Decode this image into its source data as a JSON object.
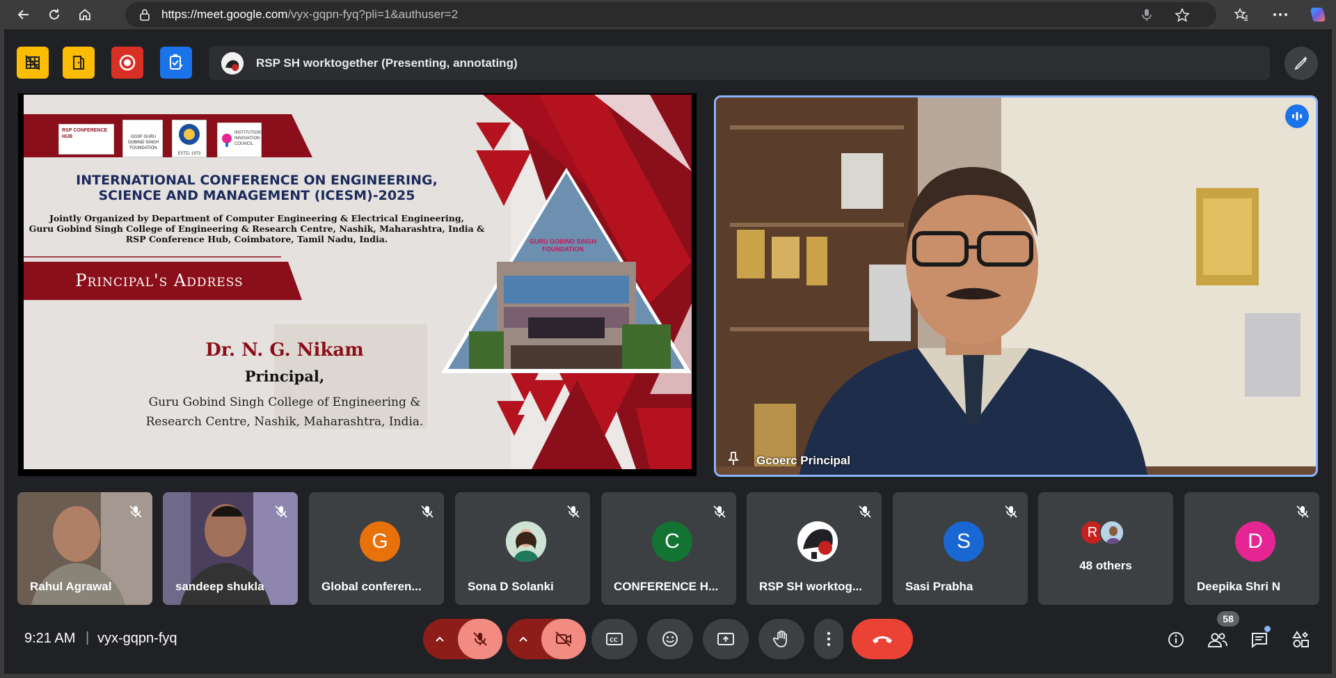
{
  "browser": {
    "url_host": "https://meet.google.com",
    "url_path": "/vyx-gqpn-fyq?pli=1&authuser=2"
  },
  "presentation": {
    "presenter_label": "RSP SH worktogether (Presenting, annotating)"
  },
  "slide": {
    "logos": [
      "RSP CONFERENCE HUB",
      "GGSF GURU GOBIND SINGH FOUNDATION",
      "ESTD. 1973",
      "INSTITUTION'S INNOVATION COUNCIL"
    ],
    "title_line1": "INTERNATIONAL CONFERENCE ON ENGINEERING,",
    "title_line2": "SCIENCE AND MANAGEMENT (ICESM)-2025",
    "org_line1": "Jointly Organized by Department of Computer Engineering & Electrical Engineering,",
    "org_line2": "Guru Gobind Singh College of Engineering & Research Centre, Nashik, Maharashtra, India &",
    "org_line3": "RSP Conference Hub, Coimbatore, Tamil Nadu, India.",
    "banner": "Principal's Address",
    "speaker_name": "Dr. N. G. Nikam",
    "speaker_role": "Principal,",
    "speaker_inst1": "Guru Gobind Singh College of Engineering &",
    "speaker_inst2": "Research Centre, Nashik, Maharashtra, India.",
    "building_sign": "GURU GOBIND SINGH FOUNDATION"
  },
  "main_video": {
    "name": "Gcoerc Principal"
  },
  "participants": [
    {
      "name": "Rahul Agrawal",
      "type": "video"
    },
    {
      "name": "sandeep shukla",
      "type": "video"
    },
    {
      "name": "Global conferen...",
      "initial": "G",
      "color": "#e8710a"
    },
    {
      "name": "Sona D Solanki",
      "type": "photo"
    },
    {
      "name": "CONFERENCE H...",
      "initial": "C",
      "color": "#137333"
    },
    {
      "name": "RSP SH worktog...",
      "type": "logo"
    },
    {
      "name": "Sasi Prabha",
      "initial": "S",
      "color": "#1967d2"
    },
    {
      "name": "48 others",
      "initial": "R",
      "color": "#c5221f"
    },
    {
      "name": "Deepika Shri N",
      "initial": "D",
      "color": "#e52592"
    }
  ],
  "footer": {
    "time": "9:21 AM",
    "separator": "|",
    "meeting_code": "vyx-gqpn-fyq",
    "people_count": "58"
  },
  "colors": {
    "accent_blue": "#8ab4f8",
    "hangup_red": "#ea4335",
    "mic_off_red": "#f28b82",
    "tool_yellow": "#fbbc04",
    "record_red": "#d93025",
    "tool_blue": "#1a73e8",
    "slide_maroon": "#8b0f1a"
  }
}
